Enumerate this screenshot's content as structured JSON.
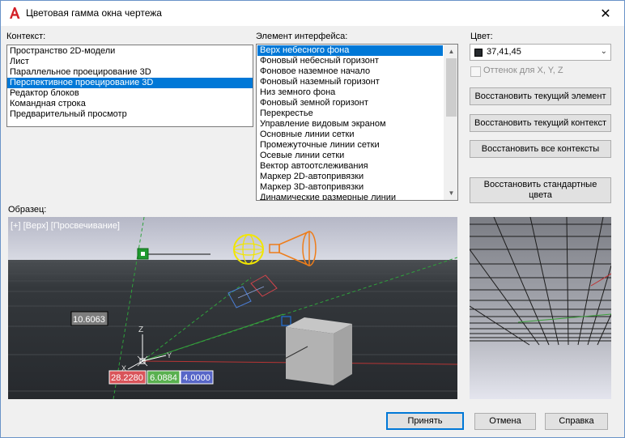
{
  "window": {
    "title": "Цветовая гамма окна чертежа",
    "close_glyph": "✕"
  },
  "context": {
    "label": "Контекст:",
    "items": [
      "Пространство 2D-модели",
      "Лист",
      "Параллельное проецирование 3D",
      "Перспективное проецирование 3D",
      "Редактор блоков",
      "Командная строка",
      "Предварительный просмотр"
    ],
    "selected_index": 3
  },
  "element": {
    "label": "Элемент интерфейса:",
    "items": [
      "Верх небесного фона",
      "Фоновый небесный горизонт",
      "Фоновое наземное начало",
      "Фоновый наземный горизонт",
      "Низ земного фона",
      "Фоновый земной горизонт",
      "Перекрестье",
      "Управление видовым экраном",
      "Основные линии сетки",
      "Промежуточные линии сетки",
      "Осевые линии сетки",
      "Вектор автоотслеживания",
      "Маркер 2D-автопривязки",
      "Маркер 3D-автопривязки",
      "Динамические размерные линии"
    ],
    "selected_index": 0,
    "scroll_fraction": 0.0
  },
  "color": {
    "label": "Цвет:",
    "value": "37,41,45",
    "swatch": "#25292d",
    "tint_label": "Оттенок для X, Y, Z",
    "tint_checked": false
  },
  "buttons": {
    "restore_element": "Восстановить текущий элемент",
    "restore_context": "Восстановить текущий контекст",
    "restore_all": "Восстановить все контексты",
    "restore_default": "Восстановить стандартные цвета",
    "ok": "Принять",
    "cancel": "Отмена",
    "help": "Справка"
  },
  "sample": {
    "label": "Образец:",
    "viewport_label": "[+] [Верх] [Просвечивание]",
    "dim_value": "10.6063",
    "coord_x": "28.2280",
    "coord_y": "6.0884",
    "coord_z": "4.0000",
    "axis_z": "Z",
    "axis_y": "Y",
    "axis_x": "X"
  },
  "colors": {
    "accent": "#0078d7",
    "coord_x_bg": "#d9545a",
    "coord_y_bg": "#59b04f",
    "coord_z_bg": "#5766c8"
  }
}
